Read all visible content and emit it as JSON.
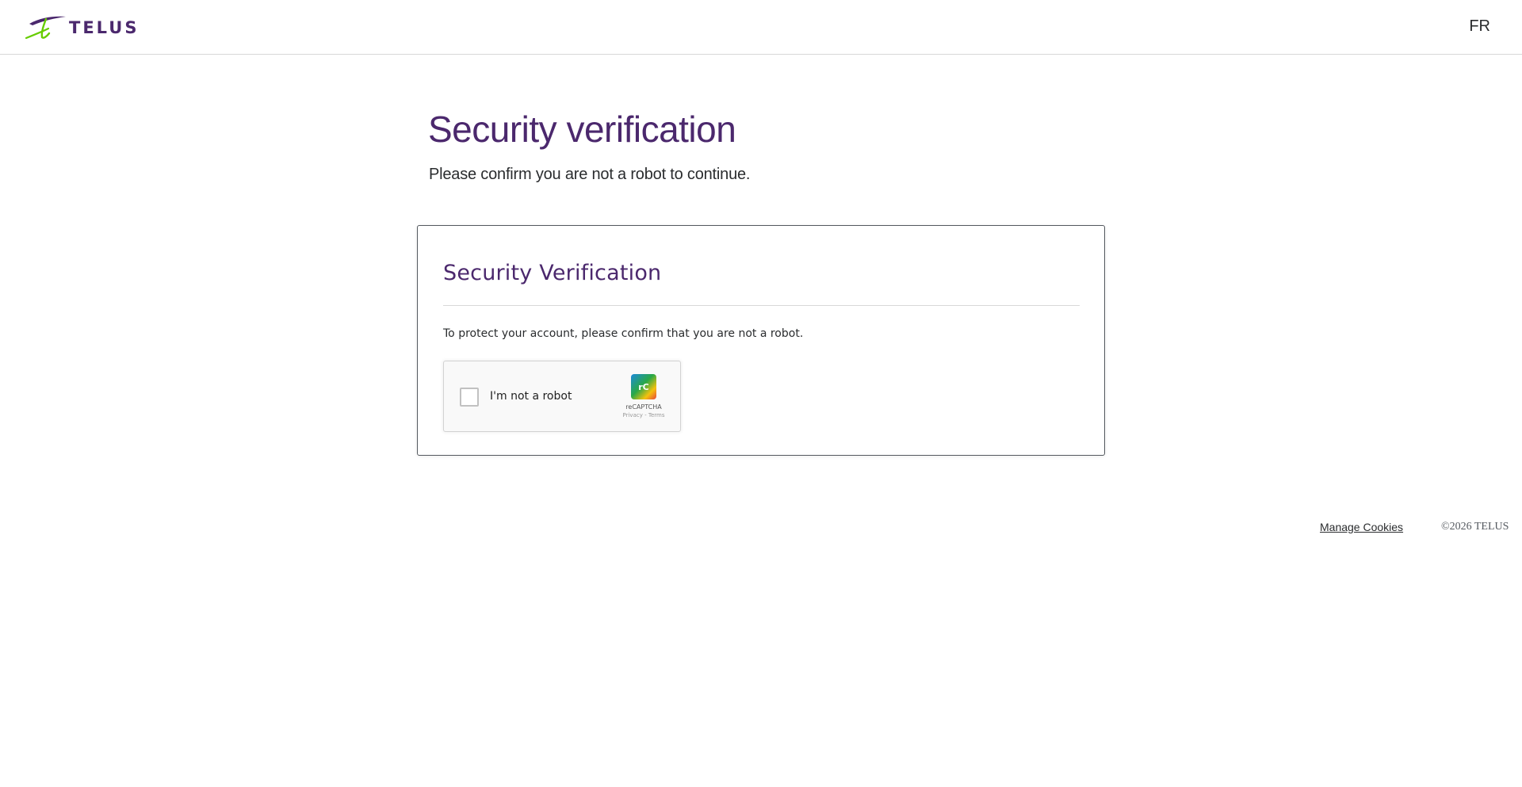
{
  "header": {
    "brand_name": "TELUS",
    "language_link": "FR"
  },
  "main": {
    "title": "Security verification",
    "subtitle": "Please confirm you are not a robot to continue."
  },
  "card": {
    "title": "Security Verification",
    "description": "To protect your account, please confirm that you are not a robot.",
    "recaptcha": {
      "label": "I'm not a robot",
      "logo_text": "rC",
      "brand": "reCAPTCHA",
      "privacy_link": "Privacy",
      "separator": " - ",
      "terms_link": "Terms",
      "checked": false
    }
  },
  "footer": {
    "manage_cookies": "Manage Cookies",
    "copyright": "©2026 TELUS"
  },
  "colors": {
    "brand_purple": "#4b286d",
    "brand_green": "#66cc00",
    "text_dark": "#2a2c2e",
    "border_gray": "#d8d8d8"
  },
  "icons": {
    "logo": "telus-logo-icon",
    "checkbox": "checkbox-unchecked-icon",
    "recaptcha": "recaptcha-logo-icon"
  }
}
